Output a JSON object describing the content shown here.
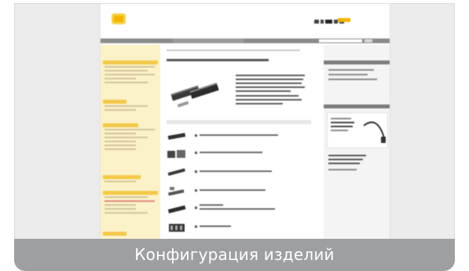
{
  "caption": {
    "label": "Конфигурация изделий"
  },
  "colors": {
    "accent": "#f1b500",
    "sidebar_bg": "#fbf2c8",
    "caption_bg": "#9e9fa2",
    "nav_bg": "#8b8b8b"
  },
  "icons": {
    "logo": "brand-logo-icon",
    "cart": "cart-icon"
  }
}
